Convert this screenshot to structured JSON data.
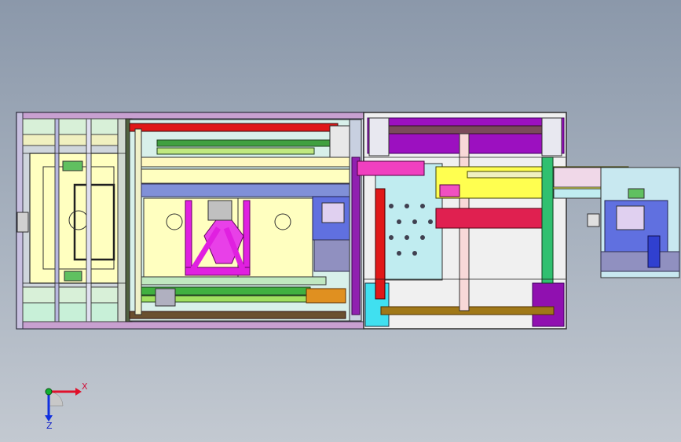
{
  "viewport": {
    "name": "cad-3d-viewport",
    "background_top": "#8b98aa",
    "background_bottom": "#c3c9d1"
  },
  "triad": {
    "x_label": "X",
    "z_label": "Z",
    "x_color": "#e0102a",
    "y_color": "#10b030",
    "z_color": "#1030e0"
  },
  "model": {
    "description_colors": {
      "frame": "#c8b8d8",
      "plate_yellow": "#ffffc0",
      "plate_cyan": "#c0f0f0",
      "magenta": "#e020e0",
      "purple": "#9010b0",
      "red": "#e01010",
      "green": "#20c020",
      "olive": "#a07818",
      "orange": "#e09020",
      "blue": "#2030d0"
    }
  }
}
